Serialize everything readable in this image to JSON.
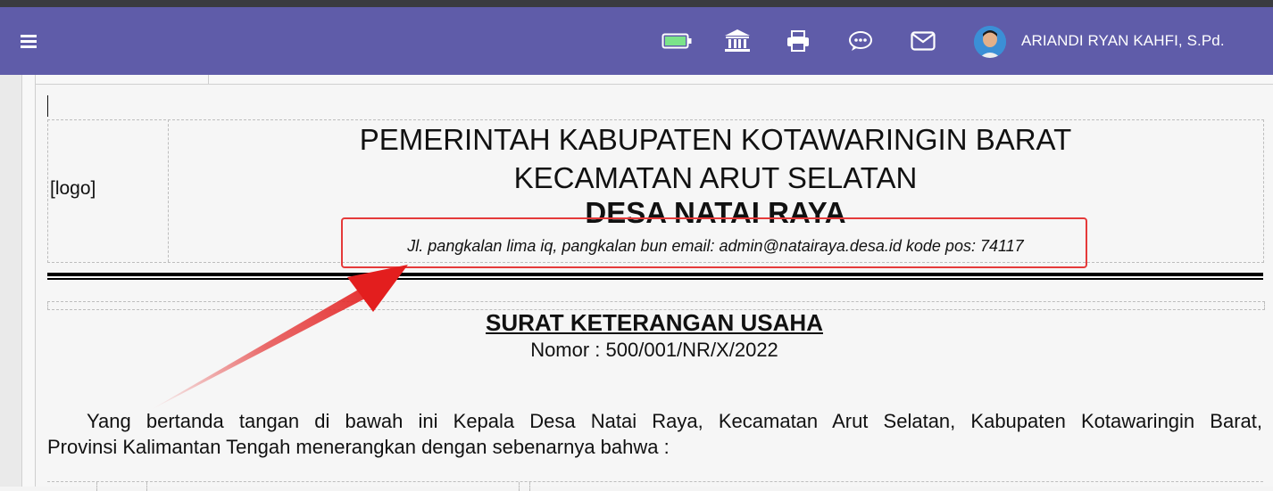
{
  "navbar": {
    "menu_icon": "hamburger-menu-icon",
    "battery_icon": "battery-icon",
    "bank_icon": "bank-icon",
    "print_icon": "printer-icon",
    "chat_icon": "chat-icon",
    "mail_icon": "mail-icon",
    "user_name": "ARIANDI RYAN KAHFI, S.Pd.",
    "accent_color": "#5f5ca9",
    "battery_color": "#7be38a"
  },
  "letterhead": {
    "logo_placeholder": "[logo]",
    "line1": "PEMERINTAH KABUPATEN KOTAWARINGIN BARAT",
    "line2": "KECAMATAN ARUT SELATAN",
    "line3": "DESA NATAI RAYA",
    "address": "Jl. pangkalan lima iq, pangkalan bun email: admin@natairaya.desa.id kode pos: 74117"
  },
  "document": {
    "title": "SURAT KETERANGAN USAHA",
    "number": "Nomor : 500/001/NR/X/2022",
    "paragraph_line1": "Yang bertanda tangan di bawah ini Kepala Desa Natai Raya, Kecamatan Arut Selatan, Kabupaten Kotawaringin Barat,",
    "paragraph_line2": "Provinsi Kalimantan Tengah menerangkan dengan sebenarnya bahwa :"
  },
  "annotation": {
    "highlight_color": "#e53a3a"
  }
}
